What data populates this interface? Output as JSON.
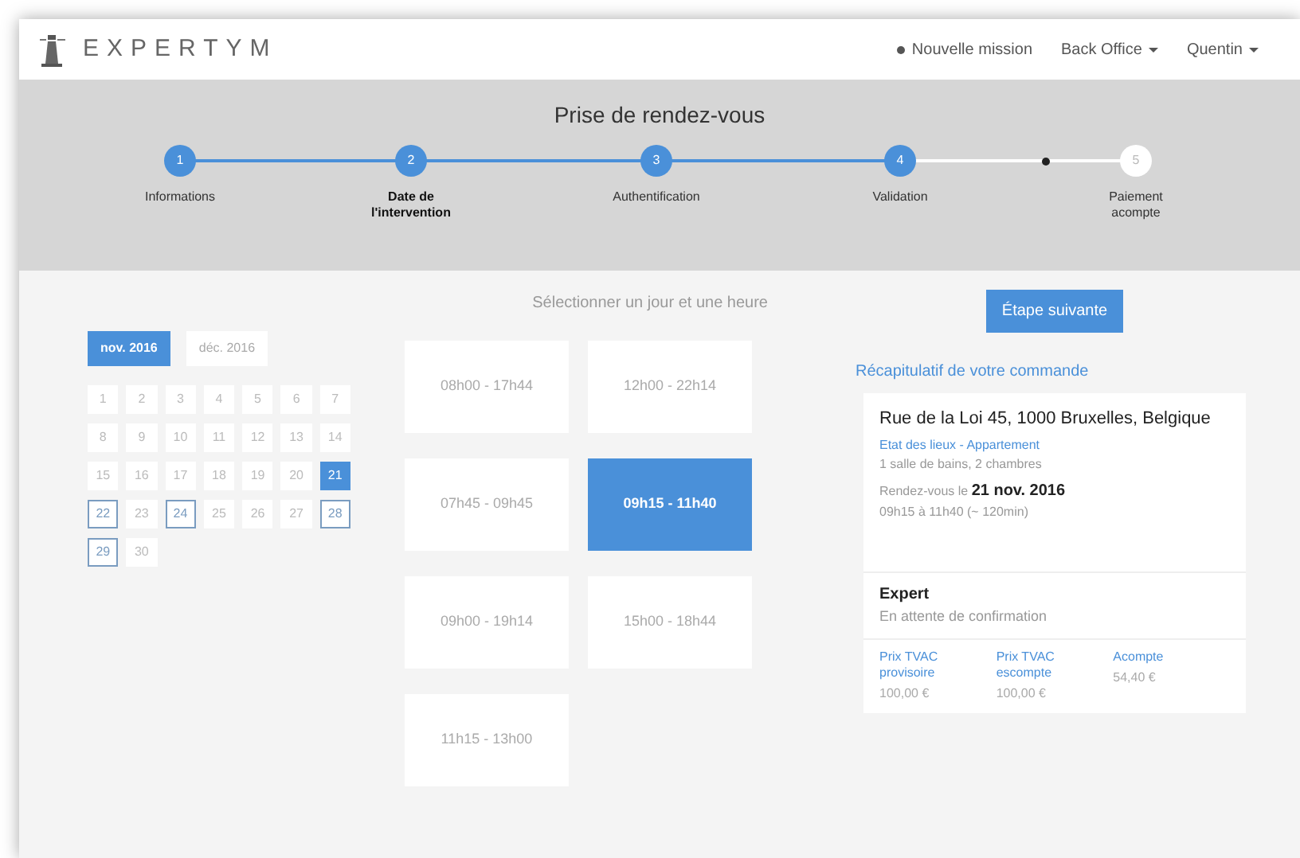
{
  "brand": {
    "name": "EXPERTYM"
  },
  "nav": [
    {
      "label": "Nouvelle mission",
      "kind": "dot"
    },
    {
      "label": "Back Office",
      "kind": "dropdown"
    },
    {
      "label": "Quentin",
      "kind": "dropdown"
    }
  ],
  "wizard": {
    "title": "Prise de rendez-vous",
    "steps": [
      {
        "number": "1",
        "label": "Informations",
        "done": true,
        "selected": false
      },
      {
        "number": "2",
        "label": "Date de l'intervention",
        "done": true,
        "selected": true
      },
      {
        "number": "3",
        "label": "Authentification",
        "done": true,
        "selected": false
      },
      {
        "number": "4",
        "label": "Validation",
        "done": true,
        "selected": false
      },
      {
        "number": "5",
        "label": "Paiement acompte",
        "done": false,
        "selected": false
      }
    ]
  },
  "calendar": {
    "months": [
      {
        "label": "nov. 2016",
        "selected": true
      },
      {
        "label": "déc. 2016",
        "selected": false
      }
    ],
    "days": [
      {
        "label": "1",
        "selected": false,
        "available": false
      },
      {
        "label": "2",
        "selected": false,
        "available": false
      },
      {
        "label": "3",
        "selected": false,
        "available": false
      },
      {
        "label": "4",
        "selected": false,
        "available": false
      },
      {
        "label": "5",
        "selected": false,
        "available": false
      },
      {
        "label": "6",
        "selected": false,
        "available": false
      },
      {
        "label": "7",
        "selected": false,
        "available": false
      },
      {
        "label": "8",
        "selected": false,
        "available": false
      },
      {
        "label": "9",
        "selected": false,
        "available": false
      },
      {
        "label": "10",
        "selected": false,
        "available": false
      },
      {
        "label": "11",
        "selected": false,
        "available": false
      },
      {
        "label": "12",
        "selected": false,
        "available": false
      },
      {
        "label": "13",
        "selected": false,
        "available": false
      },
      {
        "label": "14",
        "selected": false,
        "available": false
      },
      {
        "label": "15",
        "selected": false,
        "available": false
      },
      {
        "label": "16",
        "selected": false,
        "available": false
      },
      {
        "label": "17",
        "selected": false,
        "available": false
      },
      {
        "label": "18",
        "selected": false,
        "available": false
      },
      {
        "label": "19",
        "selected": false,
        "available": false
      },
      {
        "label": "20",
        "selected": false,
        "available": false
      },
      {
        "label": "21",
        "selected": true,
        "available": false
      },
      {
        "label": "22",
        "selected": false,
        "available": true
      },
      {
        "label": "23",
        "selected": false,
        "available": false
      },
      {
        "label": "24",
        "selected": false,
        "available": true
      },
      {
        "label": "25",
        "selected": false,
        "available": false
      },
      {
        "label": "26",
        "selected": false,
        "available": false
      },
      {
        "label": "27",
        "selected": false,
        "available": false
      },
      {
        "label": "28",
        "selected": false,
        "available": true
      },
      {
        "label": "29",
        "selected": false,
        "available": true
      },
      {
        "label": "30",
        "selected": false,
        "available": false
      }
    ]
  },
  "slots": {
    "heading": "Sélectionner un jour et une heure",
    "items": [
      {
        "label": "08h00 - 17h44",
        "selected": false
      },
      {
        "label": "12h00 - 22h14",
        "selected": false
      },
      {
        "label": "07h45 - 09h45",
        "selected": false
      },
      {
        "label": "09h15 - 11h40",
        "selected": true
      },
      {
        "label": "09h00 - 19h14",
        "selected": false
      },
      {
        "label": "15h00 - 18h44",
        "selected": false
      },
      {
        "label": "11h15 - 13h00",
        "selected": false
      }
    ]
  },
  "next_button": "Étape suivante",
  "summary": {
    "heading": "Récapitulatif de votre commande",
    "address": "Rue de la Loi 45, 1000 Bruxelles, Belgique",
    "service": "Etat des lieux - Appartement",
    "details": "1 salle de bains, 2 chambres",
    "appointment": "Rendez-vous le **21 nov. 2016**",
    "time": "09h15 à 11h40 (~ 120min)",
    "expert_title": "Expert",
    "expert_status": "En attente de confirmation",
    "prices": [
      {
        "label": "Prix TVAC provisoire",
        "value": "100,00 €"
      },
      {
        "label": "Prix TVAC escompte",
        "value": "100,00 €"
      },
      {
        "label": "Acompte",
        "value": "54,40 €"
      }
    ]
  }
}
